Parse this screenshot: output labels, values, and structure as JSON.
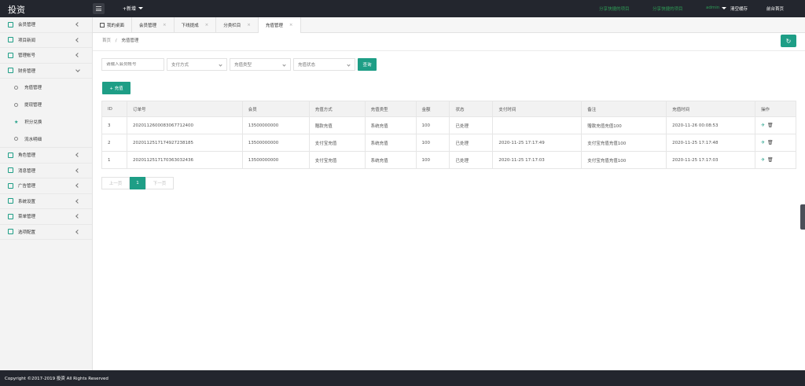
{
  "topbar": {
    "logo": "投资",
    "new_menu": "+新增",
    "links": [
      {
        "label": "分享快捷的项目",
        "style": "green"
      },
      {
        "label": "分享快捷的项目",
        "style": "green"
      },
      {
        "label": "admin",
        "style": "green"
      },
      {
        "label": "清空缓存",
        "style": "white"
      },
      {
        "label": "前台首页",
        "style": "white"
      }
    ]
  },
  "sidebar": {
    "items": [
      {
        "label": "会员管理"
      },
      {
        "label": "项目新闻"
      },
      {
        "label": "管理帐号"
      },
      {
        "label": "财务管理",
        "expanded": true,
        "children": [
          {
            "label": "充值管理"
          },
          {
            "label": "提现管理"
          },
          {
            "label": "积分兑换"
          },
          {
            "label": "流水明细"
          }
        ]
      },
      {
        "label": "角色管理"
      },
      {
        "label": "消息管理"
      },
      {
        "label": "广告管理"
      },
      {
        "label": "系统设置"
      },
      {
        "label": "菜单管理"
      },
      {
        "label": "选项配置"
      }
    ]
  },
  "tabs": [
    {
      "label": "我的桌面",
      "closable": false
    },
    {
      "label": "会员管理",
      "closable": true
    },
    {
      "label": "下线提成",
      "closable": true
    },
    {
      "label": "分类栏目",
      "closable": true
    },
    {
      "label": "充值管理",
      "closable": true,
      "active": true
    }
  ],
  "breadcrumb": {
    "home": "首页",
    "sep": "/",
    "current": "充值管理"
  },
  "filters": {
    "member_placeholder": "请输入会员帐号",
    "pay_method": "支付方式",
    "recharge_type": "充值类型",
    "recharge_status": "充值状态",
    "query_label": "查询"
  },
  "recharge_button": "+ 充值",
  "table": {
    "headers": [
      "ID",
      "订单号",
      "会员",
      "充值方式",
      "充值类型",
      "金额",
      "状态",
      "支付时间",
      "备注",
      "充值时间",
      "操作"
    ],
    "rows": [
      [
        "3",
        "20201126000830677124​00",
        "13500000000",
        "赠款充值",
        "系统充值",
        "100",
        "已处理",
        "",
        "赠款充值充值100",
        "2020-11-26 00:08:53"
      ],
      [
        "2",
        "20201125171749272381​85",
        "13500000000",
        "支付宝充值",
        "系统充值",
        "100",
        "已处理",
        "2020-11-25 17:17:49",
        "支付宝充值充值100",
        "2020-11-25 17:17:48"
      ],
      [
        "1",
        "20201125171703630324​36",
        "13500000000",
        "支付宝充值",
        "系统充值",
        "100",
        "已处理",
        "2020-11-25 17:17:03",
        "支付宝充值充值100",
        "2020-11-25 17:17:03"
      ]
    ]
  },
  "pagination": {
    "prev": "上一页",
    "current": "1",
    "next": "下一页"
  },
  "footer": "Copyright ©2017-2019 投资 All Rights Reserved",
  "colors": {
    "accent": "#1e9e86",
    "topbar": "#23262e",
    "top_link_green": "#2e9e57"
  }
}
